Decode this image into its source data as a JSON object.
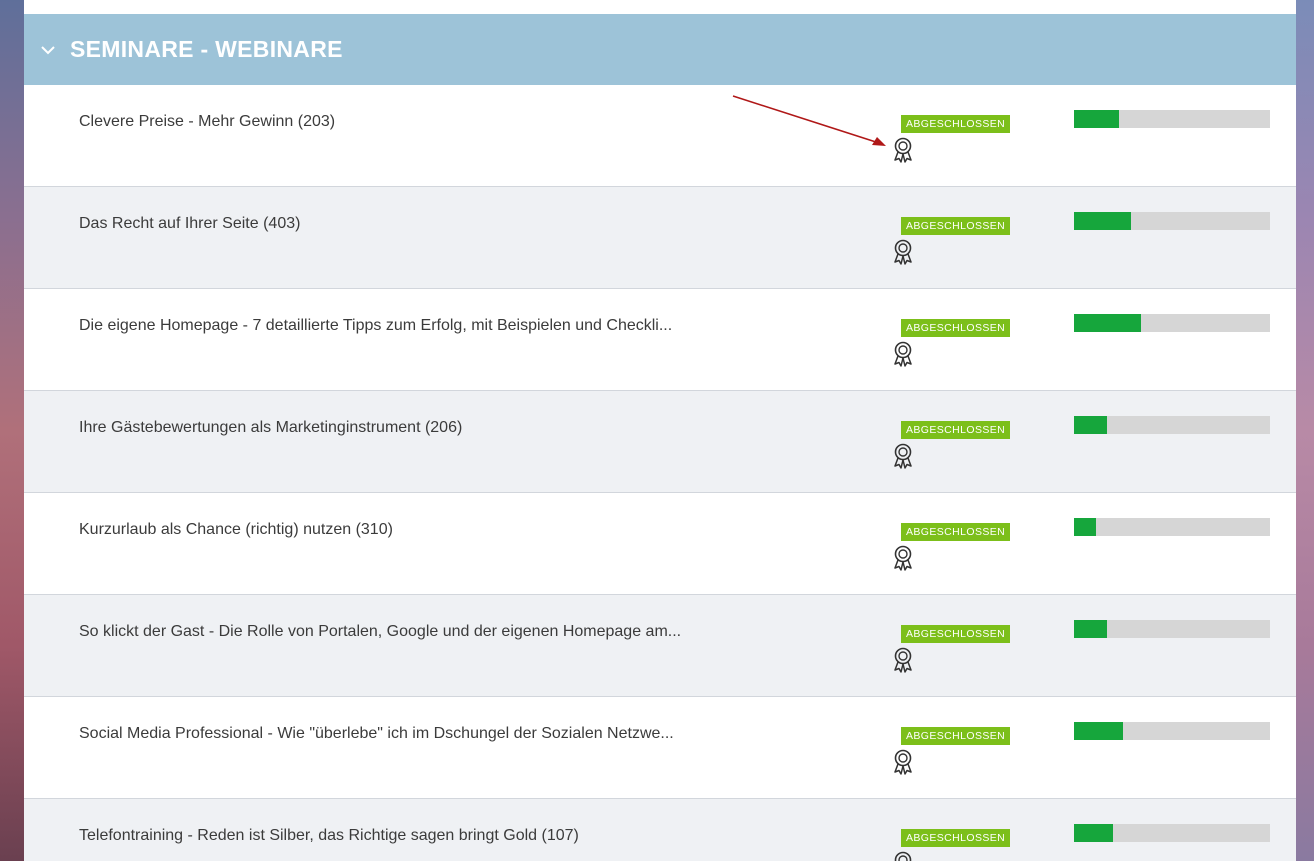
{
  "header": {
    "title": "SEMINARE - WEBINARE",
    "icon": "chevron-down-icon"
  },
  "colors": {
    "header_bg": "#9dc3d8",
    "badge": "#7cbf1a",
    "progress_fill": "#16a63c",
    "progress_track": "#d6d6d6",
    "annotation_arrow": "#b01818"
  },
  "courses": [
    {
      "title": "Clevere Preise - Mehr Gewinn (203)",
      "status": "ABGESCHLOSSEN",
      "icon": "award-icon",
      "progress": 0.23
    },
    {
      "title": "Das Recht auf Ihrer Seite (403)",
      "status": "ABGESCHLOSSEN",
      "icon": "award-icon",
      "progress": 0.29
    },
    {
      "title": "Die eigene Homepage - 7 detaillierte Tipps zum Erfolg, mit Beispielen und Checkli...",
      "status": "ABGESCHLOSSEN",
      "icon": "award-icon",
      "progress": 0.34
    },
    {
      "title": "Ihre Gästebewertungen als Marketinginstrument (206)",
      "status": "ABGESCHLOSSEN",
      "icon": "award-icon",
      "progress": 0.17
    },
    {
      "title": "Kurzurlaub als Chance (richtig) nutzen (310)",
      "status": "ABGESCHLOSSEN",
      "icon": "award-icon",
      "progress": 0.11
    },
    {
      "title": "So klickt der Gast - Die Rolle von Portalen, Google und der eigenen Homepage am...",
      "status": "ABGESCHLOSSEN",
      "icon": "award-icon",
      "progress": 0.17
    },
    {
      "title": "Social Media Professional - Wie \"überlebe\" ich im Dschungel der Sozialen Netzwe...",
      "status": "ABGESCHLOSSEN",
      "icon": "award-icon",
      "progress": 0.25
    },
    {
      "title": "Telefontraining - Reden ist Silber, das Richtige sagen bringt Gold (107)",
      "status": "ABGESCHLOSSEN",
      "icon": "award-icon",
      "progress": 0.2
    }
  ]
}
